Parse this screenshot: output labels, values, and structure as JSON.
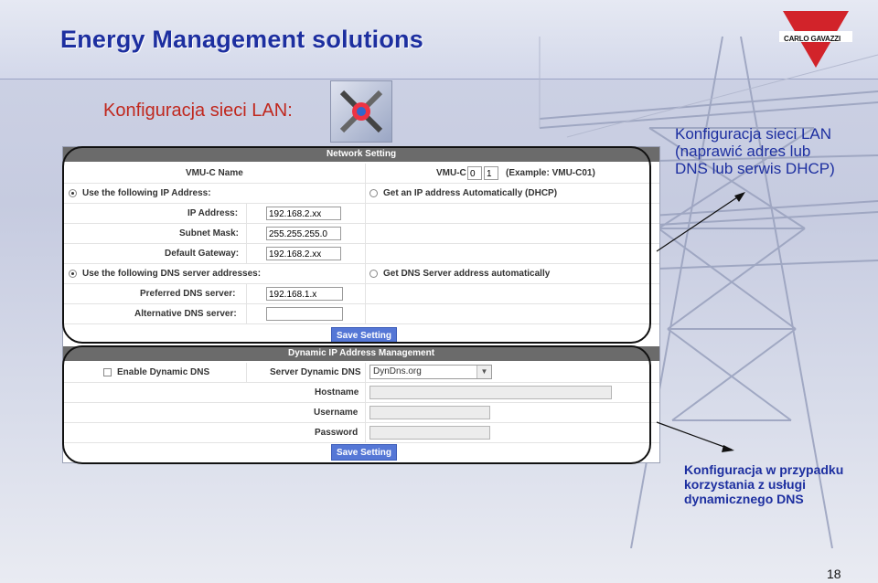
{
  "slide": {
    "title": "Energy Management  solutions",
    "subtitle": "Konfiguracja sieci LAN:",
    "logo_text": "CARLO GAVAZZI",
    "page_number": "18",
    "note1": [
      "Konfiguracja sieci LAN",
      "(naprawić adres lub",
      "DNS lub serwis DHCP)"
    ],
    "note2": [
      "Konfiguracja w przypadku",
      "korzystania z usługi",
      "dynamicznego DNS"
    ],
    "colors": {
      "title": "#1d2fa0",
      "subtitle": "#c0281e",
      "button": "#5577d6",
      "logo_red": "#d2232a"
    }
  },
  "network": {
    "header": "Network Setting",
    "vmu_name_label": "VMU-C Name",
    "vmu_prefix": "VMU-C",
    "vmu_field1": "0",
    "vmu_field2": "1",
    "vmu_example": "(Example: VMU-C01)",
    "use_ip_label": "Use the following IP Address:",
    "dhcp_label": "Get an IP address Automatically (DHCP)",
    "ip_label": "IP Address:",
    "ip_value": "192.168.2.xx",
    "mask_label": "Subnet Mask:",
    "mask_value": "255.255.255.0",
    "gateway_label": "Default Gateway:",
    "gateway_value": "192.168.2.xx",
    "use_dns_label": "Use the following DNS server addresses:",
    "auto_dns_label": "Get DNS Server address automatically",
    "pref_dns_label": "Preferred DNS server:",
    "pref_dns_value": "192.168.1.x",
    "alt_dns_label": "Alternative DNS server:",
    "alt_dns_value": "",
    "save_label": "Save Setting"
  },
  "dyndns": {
    "header": "Dynamic IP Address Management",
    "enable_label": "Enable Dynamic DNS",
    "server_label": "Server Dynamic DNS",
    "server_value": "DynDns.org",
    "host_label": "Hostname",
    "user_label": "Username",
    "pass_label": "Password",
    "save_label": "Save Setting"
  }
}
